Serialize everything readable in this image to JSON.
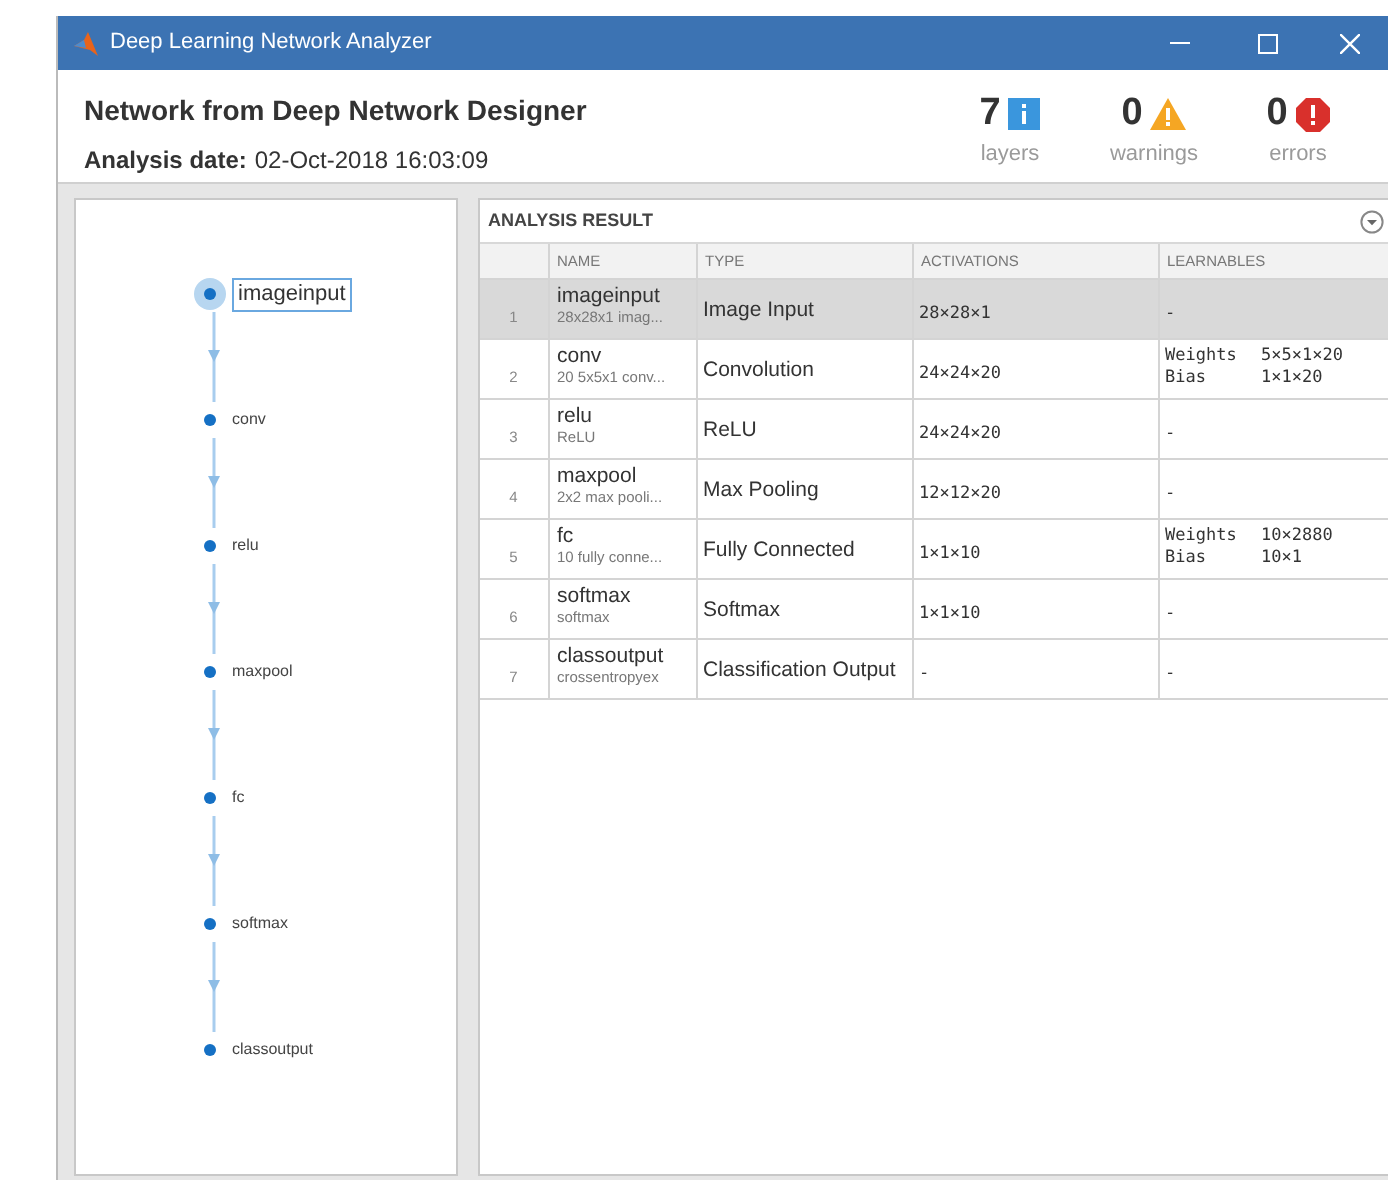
{
  "window": {
    "title": "Deep Learning Network Analyzer"
  },
  "header": {
    "title": "Network from Deep Network Designer",
    "date_label": "Analysis date:",
    "date": "02-Oct-2018 16:03:09"
  },
  "summary": [
    {
      "kind": "info",
      "count": "7",
      "label": "layers"
    },
    {
      "kind": "warning",
      "count": "0",
      "label": "warnings"
    },
    {
      "kind": "error",
      "count": "0",
      "label": "errors"
    }
  ],
  "graph": {
    "nodes": [
      {
        "name": "imageinput",
        "selected": true
      },
      {
        "name": "conv",
        "selected": false
      },
      {
        "name": "relu",
        "selected": false
      },
      {
        "name": "maxpool",
        "selected": false
      },
      {
        "name": "fc",
        "selected": false
      },
      {
        "name": "softmax",
        "selected": false
      },
      {
        "name": "classoutput",
        "selected": false
      }
    ]
  },
  "result": {
    "title": "ANALYSIS RESULT",
    "columns": [
      "NAME",
      "TYPE",
      "ACTIVATIONS",
      "LEARNABLES"
    ],
    "rows": [
      {
        "index": "1",
        "name": "imageinput",
        "description": "28x28x1 imag...",
        "type": "Image Input",
        "activations": "28×28×1",
        "learnables": "-",
        "selected": true
      },
      {
        "index": "2",
        "name": "conv",
        "description": "20 5x5x1 conv...",
        "type": "Convolution",
        "activations": "24×24×20",
        "learnables": [
          {
            "name": "Weights",
            "value": "5×5×1×20"
          },
          {
            "name": "Bias",
            "value": "1×1×20"
          }
        ],
        "selected": false
      },
      {
        "index": "3",
        "name": "relu",
        "description": "ReLU",
        "type": "ReLU",
        "activations": "24×24×20",
        "learnables": "-",
        "selected": false
      },
      {
        "index": "4",
        "name": "maxpool",
        "description": "2x2 max pooli...",
        "type": "Max Pooling",
        "activations": "12×12×20",
        "learnables": "-",
        "selected": false
      },
      {
        "index": "5",
        "name": "fc",
        "description": "10 fully conne...",
        "type": "Fully Connected",
        "activations": "1×1×10",
        "learnables": [
          {
            "name": "Weights",
            "value": "10×2880"
          },
          {
            "name": "Bias",
            "value": "10×1"
          }
        ],
        "selected": false
      },
      {
        "index": "6",
        "name": "softmax",
        "description": "softmax",
        "type": "Softmax",
        "activations": "1×1×10",
        "learnables": "-",
        "selected": false
      },
      {
        "index": "7",
        "name": "classoutput",
        "description": "crossentropyex",
        "type": "Classification Output",
        "activations": "-",
        "learnables": "-",
        "selected": false
      }
    ]
  }
}
